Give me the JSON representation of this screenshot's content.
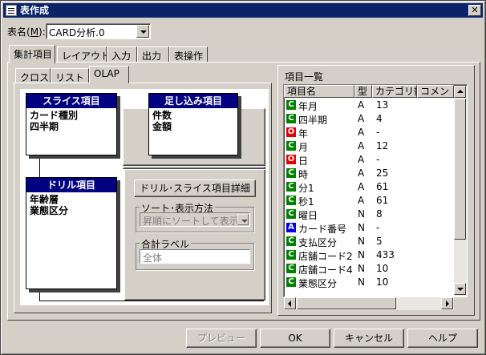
{
  "window": {
    "title": "表作成"
  },
  "form": {
    "table_name_label": "表名(",
    "table_name_key": "M",
    "table_name_label_end": "):",
    "table_name_value": "CARD分析.0"
  },
  "tabs": [
    {
      "label": "集計項目",
      "selected": true
    },
    {
      "label": "レイアウト",
      "selected": false
    },
    {
      "label": "入力",
      "selected": false
    },
    {
      "label": "出力",
      "selected": false
    },
    {
      "label": "表操作",
      "selected": false
    }
  ],
  "subtabs": [
    {
      "label": "クロス",
      "selected": false
    },
    {
      "label": "リスト",
      "selected": false
    },
    {
      "label": "OLAP",
      "selected": true
    }
  ],
  "olap": {
    "slice": {
      "title": "スライス項目",
      "items": [
        "カード種別",
        "四半期"
      ]
    },
    "sum": {
      "title": "足し込み項目",
      "items": [
        "件数",
        "金額"
      ]
    },
    "drill": {
      "title": "ドリル項目",
      "items": [
        "年齢層",
        "業態区分"
      ]
    },
    "detail_button": "ドリル･スライス項目詳細",
    "sort_group": "ソート･表示方法",
    "sort_value": "昇順にソートして表示",
    "total_group": "合計ラベル",
    "total_value": "全体"
  },
  "item_list": {
    "title": "項目一覧",
    "columns": [
      "項目名",
      "型",
      "カテゴリ数",
      "コメン"
    ],
    "rows": [
      {
        "icon": "C",
        "name": "年月",
        "type": "A",
        "count": "13"
      },
      {
        "icon": "C",
        "name": "四半期",
        "type": "A",
        "count": "4"
      },
      {
        "icon": "O",
        "name": "年",
        "type": "A",
        "count": "-"
      },
      {
        "icon": "C",
        "name": "月",
        "type": "A",
        "count": "12"
      },
      {
        "icon": "O",
        "name": "日",
        "type": "A",
        "count": "-"
      },
      {
        "icon": "C",
        "name": "時",
        "type": "A",
        "count": "25"
      },
      {
        "icon": "C",
        "name": "分1",
        "type": "A",
        "count": "61"
      },
      {
        "icon": "C",
        "name": "秒1",
        "type": "A",
        "count": "61"
      },
      {
        "icon": "C",
        "name": "曜日",
        "type": "N",
        "count": "8"
      },
      {
        "icon": "A",
        "name": "カード番号",
        "type": "N",
        "count": "-"
      },
      {
        "icon": "C",
        "name": "支払区分",
        "type": "N",
        "count": "5"
      },
      {
        "icon": "C",
        "name": "店舗コード2",
        "type": "N",
        "count": "433"
      },
      {
        "icon": "C",
        "name": "店舗コード4",
        "type": "N",
        "count": "10"
      },
      {
        "icon": "C",
        "name": "業態区分",
        "type": "N",
        "count": "10"
      }
    ]
  },
  "icon_colors": {
    "C": "#008000",
    "O": "#e00000",
    "A": "#0000e0"
  },
  "buttons": {
    "preview": "プレビュー",
    "ok": "OK",
    "cancel": "キャンセル",
    "help": "ヘルプ"
  }
}
